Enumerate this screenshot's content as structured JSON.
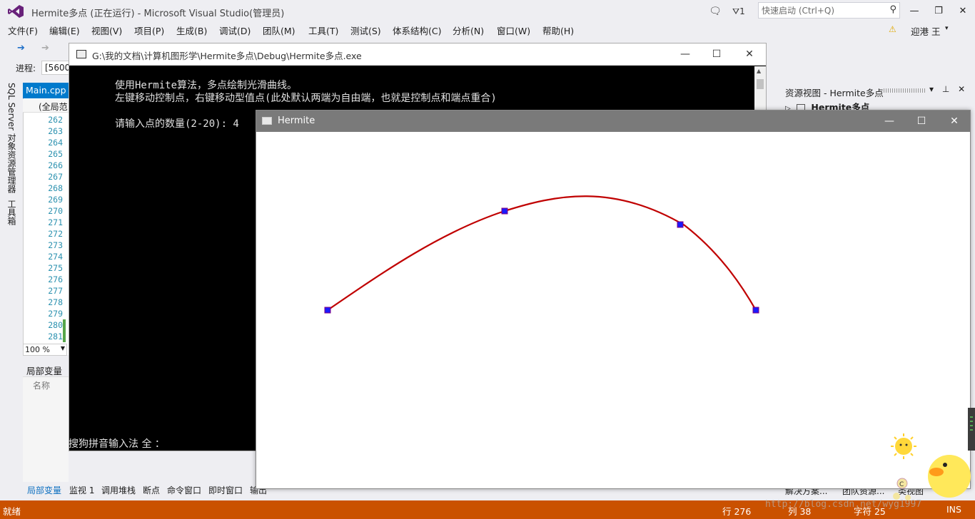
{
  "vs_window": {
    "title": "Hermite多点 (正在运行) - Microsoft Visual Studio(管理员)",
    "notification_count": "1",
    "quick_launch_placeholder": "快速启动 (Ctrl+Q)",
    "minimize": "—",
    "restore": "❐",
    "close": "✕"
  },
  "menu": {
    "items": [
      "文件(F)",
      "编辑(E)",
      "视图(V)",
      "项目(P)",
      "生成(B)",
      "调试(D)",
      "团队(M)",
      "工具(T)",
      "测试(S)",
      "体系结构(C)",
      "分析(N)",
      "窗口(W)",
      "帮助(H)"
    ],
    "user": "迎港 王"
  },
  "toolbar": {
    "progress_label": "进程:",
    "progress_value": "[5600"
  },
  "left_sidebar": {
    "tab1": "SQL Server 对象资源管理器",
    "tab2": "工具箱"
  },
  "editor": {
    "doc_tab": "Main.cpp",
    "scope": "(全局范",
    "line_numbers": [
      "262",
      "263",
      "264",
      "265",
      "266",
      "267",
      "268",
      "269",
      "270",
      "271",
      "272",
      "273",
      "274",
      "275",
      "276",
      "277",
      "278",
      "279",
      "280",
      "281"
    ],
    "zoom": "100 %"
  },
  "locals": {
    "header": "局部变量",
    "column_name": "名称"
  },
  "bottom_tabs": [
    "局部变量",
    "监视 1",
    "调用堆栈",
    "断点",
    "命令窗口",
    "即时窗口",
    "输出"
  ],
  "resource_view": {
    "title": "资源视图 - Hermite多点",
    "tree_root": "Hermite多点",
    "bottom_items": [
      "解决方案...",
      "团队资源...",
      "类视图"
    ]
  },
  "console": {
    "title": "G:\\我的文档\\计算机图形学\\Hermite多点\\Debug\\Hermite多点.exe",
    "lines": [
      "使用Hermite算法，多点绘制光滑曲线。",
      "左键移动控制点，右键移动型值点(此处默认两端为自由端，也就是控制点和端点重合)",
      "请输入点的数量(2-20): 4"
    ],
    "ime": "搜狗拼音输入法 全 ："
  },
  "hermite_window": {
    "title": "Hermite",
    "curve_color": "#c00000",
    "point_color": "#1a1aff"
  },
  "status_bar": {
    "state": "就绪",
    "line": "行 276",
    "col": "列 38",
    "char": "字符 25",
    "ins": "INS"
  },
  "watermark": "http://blog.csdn.net/wyg1997",
  "colors": {
    "accent": "#007acc",
    "status": "#ca5100"
  }
}
